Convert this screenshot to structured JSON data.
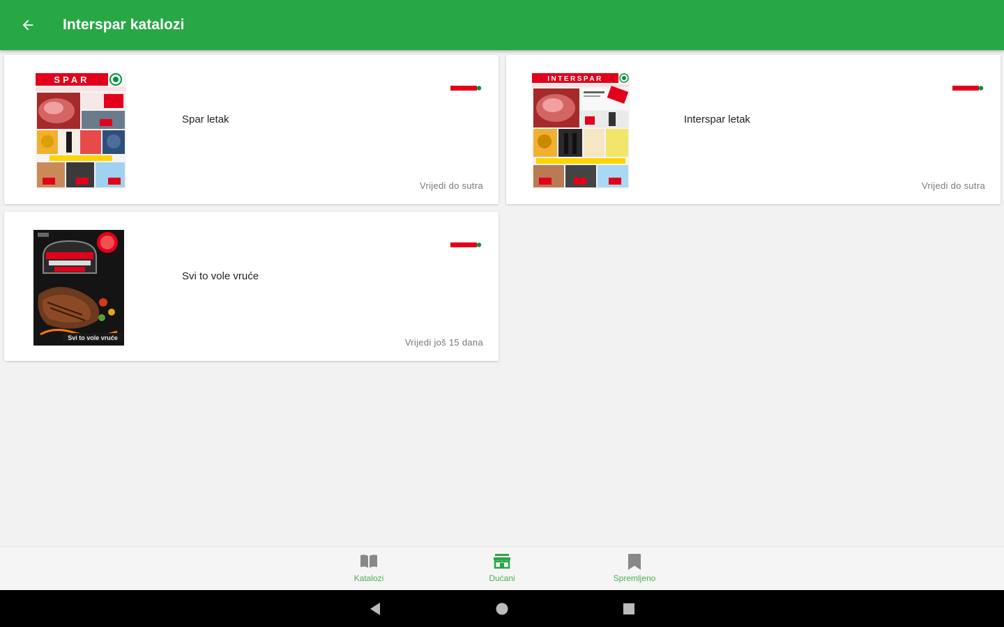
{
  "appbar": {
    "title": "Interspar katalozi"
  },
  "catalogs": [
    {
      "title": "Spar letak",
      "validity": "Vrijedi do sutra",
      "cover_brand": "SPAR"
    },
    {
      "title": "Interspar letak",
      "validity": "Vrijedi do sutra",
      "cover_brand": "INTERSPAR"
    },
    {
      "title": "Svi to vole vruće",
      "validity": "Vrijedi još 15 dana",
      "cover_brand": ""
    }
  ],
  "bottom_nav": {
    "items": [
      {
        "label": "Katalozi",
        "icon": "book-open-icon",
        "active": false
      },
      {
        "label": "Dućani",
        "icon": "store-icon",
        "active": true
      },
      {
        "label": "Spremljeno",
        "icon": "bookmark-icon",
        "active": false
      }
    ]
  },
  "colors": {
    "primary": "#28a745",
    "spar_red": "#e3001b",
    "spar_green": "#00933c"
  }
}
